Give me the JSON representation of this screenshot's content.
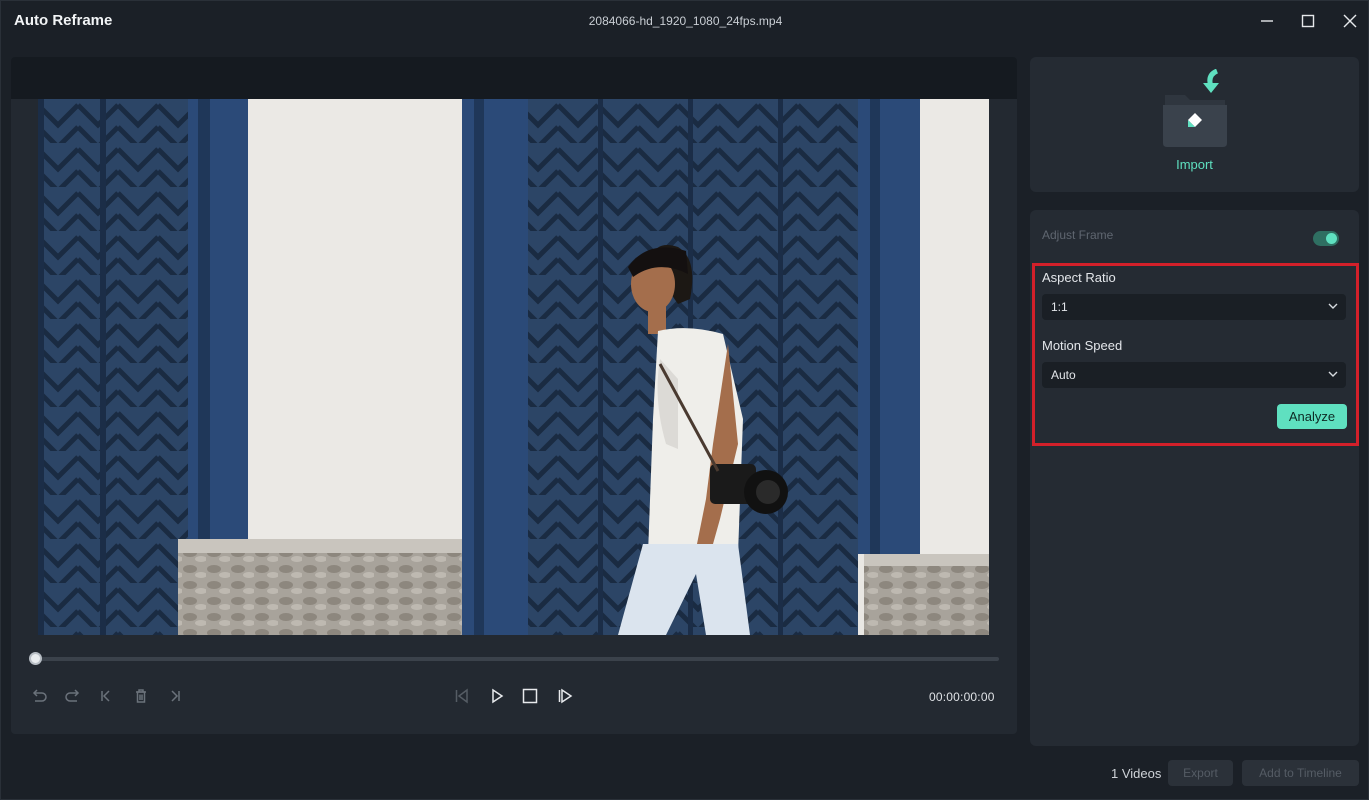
{
  "window": {
    "title": "Auto Reframe",
    "file_name": "2084066-hd_1920_1080_24fps.mp4"
  },
  "player": {
    "timecode": "00:00:00:00",
    "progress": 0
  },
  "import": {
    "label": "Import"
  },
  "settings": {
    "adjust_frame_label": "Adjust Frame",
    "adjust_frame_enabled": true,
    "aspect_ratio_label": "Aspect Ratio",
    "aspect_ratio_value": "1:1",
    "motion_speed_label": "Motion Speed",
    "motion_speed_value": "Auto",
    "analyze_label": "Analyze"
  },
  "footer": {
    "video_count": "1 Videos",
    "export_label": "Export",
    "add_to_timeline_label": "Add to Timeline"
  },
  "colors": {
    "accent": "#5fe0c0",
    "highlight_border": "#d3202a",
    "background": "#1b2027",
    "panel": "#252b33"
  }
}
